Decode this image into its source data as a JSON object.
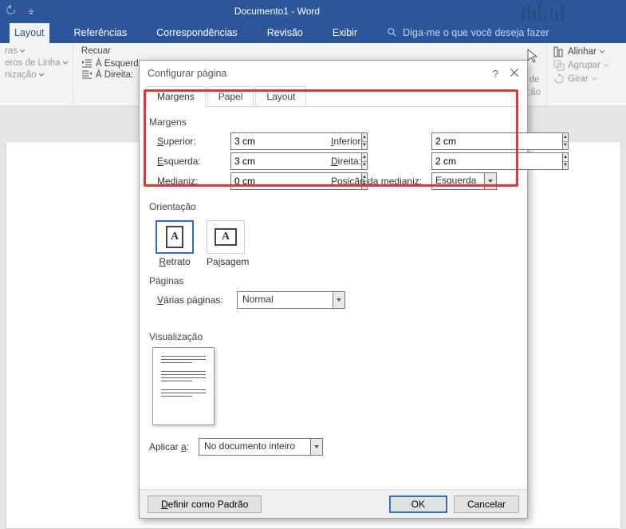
{
  "title_bar": {
    "title": "Documento1 - Word"
  },
  "ribbon_tabs": {
    "layout": "Layout",
    "referencias": "Referências",
    "correspondencias": "Correspondências",
    "revisao": "Revisão",
    "exibir": "Exibir",
    "tellme": "Diga-me o que você deseja fazer"
  },
  "ribbon": {
    "partial1": "ras",
    "partial2": "eros de Linha",
    "partial3": "nização",
    "recuar_title": "Recuar",
    "a_esquerd": "À Esquerd",
    "a_direita": "À Direita:",
    "partial4": "l de",
    "partial5": ";ão",
    "alinhar": "Alinhar",
    "agrupar": "Agrupar",
    "girar": "Girar"
  },
  "dialog": {
    "title": "Configurar página",
    "tabs": {
      "margens": "Margens",
      "papel": "Papel",
      "layout": "Layout"
    },
    "section_margens": "Margens",
    "fields": {
      "superior_label": "Superior:",
      "superior_value": "3 cm",
      "inferior_label": "Inferior:",
      "inferior_value": "2 cm",
      "esquerda_label": "Esquerda:",
      "esquerda_value": "3 cm",
      "direita_label": "Direita:",
      "direita_value": "2 cm",
      "medianiz_label": "Medianiz:",
      "medianiz_value": "0 cm",
      "posmed_label": "Posição da medianiz:",
      "posmed_value": "Esquerda"
    },
    "section_orient": "Orientação",
    "orient_retrato": "Retrato",
    "orient_paisagem": "Paisagem",
    "section_paginas": "Páginas",
    "varias_label": "Várias páginas:",
    "varias_value": "Normal",
    "section_visual": "Visualização",
    "aplicar_label": "Aplicar a:",
    "aplicar_value": "No documento inteiro",
    "definir_padrao": "Definir como Padrão",
    "ok": "OK",
    "cancelar": "Cancelar"
  }
}
